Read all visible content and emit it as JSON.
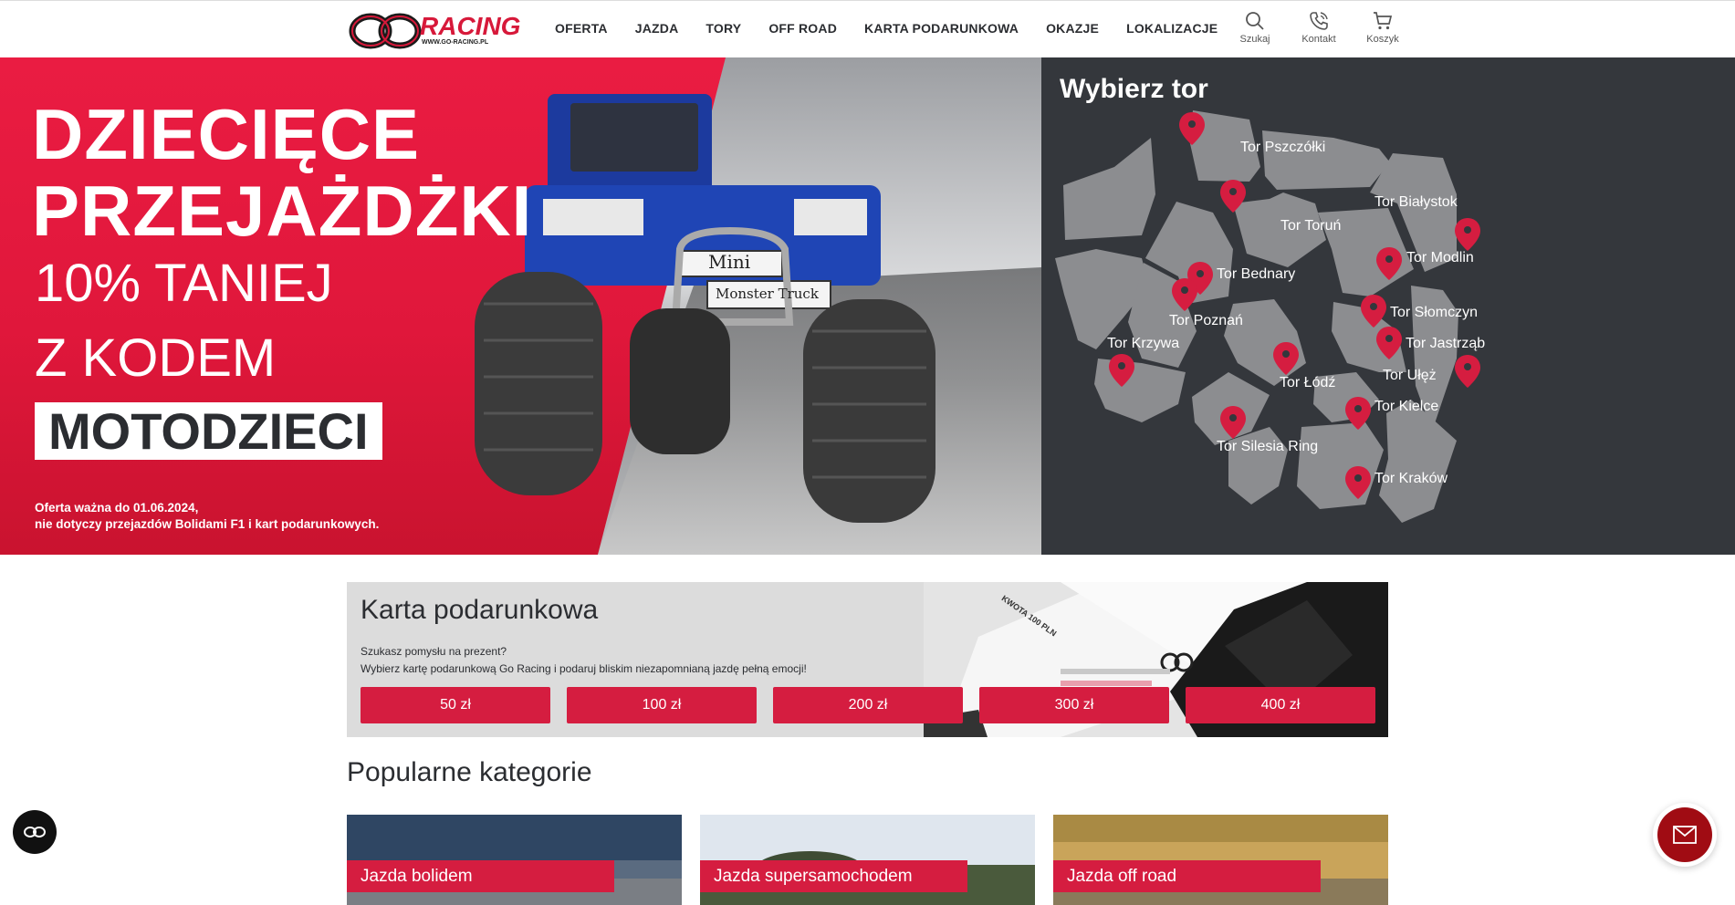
{
  "header": {
    "logo_text": "RACING",
    "logo_url": "WWW.GO-RACING.PL",
    "nav": [
      "OFERTA",
      "JAZDA",
      "TORY",
      "OFF ROAD",
      "KARTA PODARUNKOWA",
      "OKAZJE",
      "LOKALIZACJE"
    ],
    "tools": {
      "search": "Szukaj",
      "contact": "Kontakt",
      "cart": "Koszyk"
    }
  },
  "hero": {
    "title_line1": "DZIECIĘCE",
    "title_line2": "PRZEJAŻDŻKI",
    "sub1": "10% TANIEJ",
    "sub2": "Z KODEM",
    "code": "MOTODZIECI",
    "note_line1": "Oferta ważna do 01.06.2024,",
    "note_line2": "nie dotyczy przejazdów Bolidami F1 i kart podarunkowych.",
    "plate_top": "Mini",
    "plate_bottom": "Monster Truck"
  },
  "map": {
    "title": "Wybierz tor",
    "tracks": [
      "Tor Pszczółki",
      "Tor Białystok",
      "Tor Toruń",
      "Tor Modlin",
      "Tor Bednary",
      "Tor Poznań",
      "Tor Słomczyn",
      "Tor Krzywa",
      "Tor Jastrząb",
      "Tor Łódź",
      "Tor Ułęż",
      "Tor Kielce",
      "Tor Silesia Ring",
      "Tor Kraków"
    ]
  },
  "gift": {
    "title": "Karta podarunkowa",
    "desc_line1": "Szukasz pomysłu na prezent?",
    "desc_line2": "Wybierz kartę podarunkową Go Racing i podaruj bliskim niezapomnianą jazdę pełną emocji!",
    "buttons": [
      "50 zł",
      "100 zł",
      "200 zł",
      "300 zł",
      "400 zł"
    ],
    "card_text": "KWOTA 100 PLN"
  },
  "popular": {
    "title": "Popularne kategorie",
    "cards": [
      "Jazda bolidem",
      "Jazda supersamochodem",
      "Jazda off road"
    ]
  },
  "colors": {
    "accent": "#d51d40",
    "dark_panel": "#34373c",
    "map_region": "#8c8d90"
  }
}
